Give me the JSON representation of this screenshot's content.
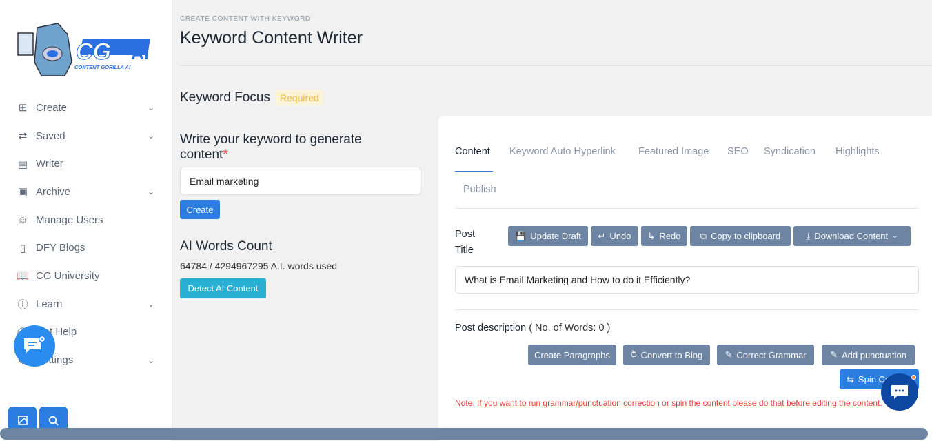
{
  "logo": {
    "text": "CG AI",
    "tagline": "CONTENT GORILLA AI"
  },
  "sidebar": {
    "items": [
      {
        "label": "Create",
        "icon": "file-plus-icon",
        "chevron": true
      },
      {
        "label": "Saved",
        "icon": "repeat-icon",
        "chevron": true
      },
      {
        "label": "Writer",
        "icon": "file-text-icon",
        "chevron": false
      },
      {
        "label": "Archive",
        "icon": "archive-icon",
        "chevron": true
      },
      {
        "label": "Manage Users",
        "icon": "user-icon",
        "chevron": false
      },
      {
        "label": "DFY Blogs",
        "icon": "tablet-icon",
        "chevron": false
      },
      {
        "label": "CG University",
        "icon": "book-icon",
        "chevron": false
      },
      {
        "label": "Learn",
        "icon": "info-icon",
        "chevron": true
      },
      {
        "label": "Get Help",
        "icon": "help-icon",
        "chevron": false
      },
      {
        "label": "Settings",
        "icon": "gear-icon",
        "chevron": true
      }
    ]
  },
  "header": {
    "breadcrumb": "CREATE CONTENT WITH KEYWORD",
    "title": "Keyword Content Writer"
  },
  "keyword": {
    "focus_label": "Keyword Focus",
    "required": "Required",
    "prompt": "Write your keyword to generate content",
    "star": "*",
    "value": "Email marketing",
    "create": "Create"
  },
  "ai_words": {
    "title": "AI Words Count",
    "used": "64784 / 4294967295 A.I. words used",
    "detect": "Detect AI Content"
  },
  "tabs": [
    "Content",
    "Keyword Auto Hyperlink",
    "Featured Image",
    "SEO",
    "Syndication",
    "Highlights",
    "Publish"
  ],
  "post": {
    "title_label": "Post Title",
    "title_value": "What is Email Marketing and How to do it Efficiently?",
    "desc_label": "Post description",
    "desc_count": "( No. of Words: 0 )"
  },
  "toolbar": {
    "update": "Update Draft",
    "undo": "Undo",
    "redo": "Redo",
    "copy": "Copy to clipboard",
    "download": "Download Content"
  },
  "desc_actions": {
    "paragraphs": "Create Paragraphs",
    "blog": "Convert to Blog",
    "grammar": "Correct Grammar",
    "punctuation": "Add punctuation",
    "spin": "Spin Content"
  },
  "note": {
    "prefix": "Note: ",
    "text": "If you want to run grammar/punctuation correction or spin the content please do that before editing the content."
  },
  "colors": {
    "primary": "#2b7de0",
    "secondary": "#6e84a3",
    "info": "#2ab0d4",
    "danger": "#e53e3e"
  }
}
